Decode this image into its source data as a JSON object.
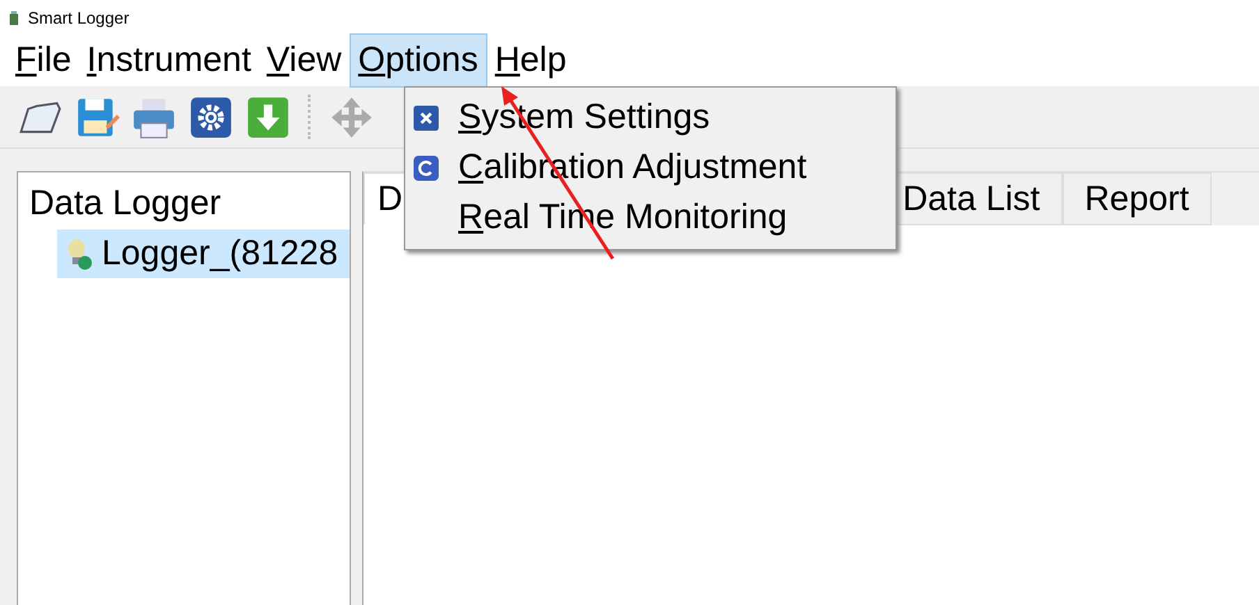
{
  "window": {
    "title": "Smart Logger"
  },
  "menu_bar": [
    {
      "label": "File",
      "selected": false
    },
    {
      "label": "Instrument",
      "selected": false
    },
    {
      "label": "View",
      "selected": false
    },
    {
      "label": "Options",
      "selected": true
    },
    {
      "label": "Help",
      "selected": false
    }
  ],
  "toolbar": [
    {
      "kind": "folder"
    },
    {
      "kind": "save"
    },
    {
      "kind": "print"
    },
    {
      "kind": "gear"
    },
    {
      "kind": "download"
    },
    {
      "kind": "separator"
    },
    {
      "kind": "move"
    }
  ],
  "tree": {
    "title": "Data Logger",
    "items": [
      {
        "label": "Logger_(81228",
        "selected": true
      }
    ]
  },
  "tabs": [
    {
      "label": "D",
      "selected": true
    },
    {
      "label": "Data List",
      "selected": false
    },
    {
      "label": "Report",
      "selected": false
    }
  ],
  "dropdown": [
    {
      "label": "System Settings",
      "kind": "settings"
    },
    {
      "label": "Calibration Adjustment",
      "kind": "calibration"
    },
    {
      "label": "Real Time Monitoring",
      "kind": "plain"
    }
  ]
}
